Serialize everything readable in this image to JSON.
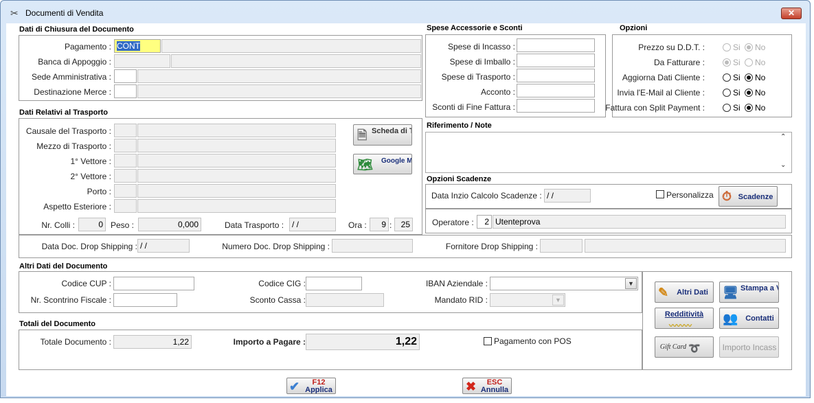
{
  "window": {
    "title": "Documenti di Vendita",
    "close": "✕"
  },
  "sections": {
    "chiusura": "Dati di Chiusura del Documento",
    "trasporto": "Dati Relativi al Trasporto",
    "spese": "Spese Accessorie e Sconti",
    "opzioni": "Opzioni",
    "riferimento": "Riferimento / Note",
    "scadenze": "Opzioni Scadenze",
    "altri": "Altri Dati del Documento",
    "totali": "Totali del Documento"
  },
  "chiusura": {
    "pagamento_label": "Pagamento :",
    "pagamento_value": "CONT",
    "banca_label": "Banca di Appoggio :",
    "sede_label": "Sede Amministrativa :",
    "destinazione_label": "Destinazione Merce :"
  },
  "trasporto": {
    "causale_label": "Causale del Trasporto :",
    "mezzo_label": "Mezzo di Trasporto :",
    "vettore1_label": "1° Vettore :",
    "vettore2_label": "2° Vettore :",
    "porto_label": "Porto :",
    "aspetto_label": "Aspetto Esteriore :",
    "colli_label": "Nr. Colli :",
    "colli_value": "0",
    "peso_label": "Peso :",
    "peso_value": "0,000",
    "data_label": "Data Trasporto :",
    "data_value": "/ /",
    "ora_label": "Ora :",
    "ora_h": "9",
    "ora_sep": ":",
    "ora_m": "25",
    "scheda_btn": "Scheda di Trasporto",
    "map_btn": "Google Map"
  },
  "dropship": {
    "data_label": "Data Doc. Drop Shipping :",
    "data_value": "/ /",
    "numero_label": "Numero Doc. Drop Shipping :",
    "fornitore_label": "Fornitore Drop Shipping :"
  },
  "spese": {
    "incasso_label": "Spese di Incasso :",
    "imballo_label": "Spese di Imballo :",
    "trasporto_label": "Spese di Trasporto :",
    "acconto_label": "Acconto :",
    "sconti_label": "Sconti di Fine Fattura :"
  },
  "opzioni": {
    "si": "Si",
    "no": "No",
    "items": [
      {
        "label": "Prezzo su D.D.T. :"
      },
      {
        "label": "Da Fatturare :"
      },
      {
        "label": "Aggiorna Dati Cliente :"
      },
      {
        "label": "Invia l'E-Mail al Cliente :"
      },
      {
        "label": "Fattura con Split Payment :"
      }
    ]
  },
  "scadenze": {
    "data_label": "Data Inzio Calcolo Scadenze :",
    "data_value": "/ /",
    "personalizza": "Personalizza",
    "scadenze_btn": "Scadenze",
    "operatore_label": "Operatore :",
    "operatore_code": "2",
    "operatore_name": "Utenteprova"
  },
  "altri": {
    "cup_label": "Codice CUP :",
    "cig_label": "Codice CIG :",
    "iban_label": "IBAN Aziendale :",
    "scontrino_label": "Nr. Scontrino Fiscale :",
    "sconto_label": "Sconto Cassa :",
    "mandato_label": "Mandato RID :"
  },
  "totali": {
    "totale_label": "Totale Documento :",
    "totale_value": "1,22",
    "importo_label": "Importo a Pagare :",
    "importo_value": "1,22",
    "pos_label": "Pagamento con POS"
  },
  "side_buttons": {
    "altri_dati": "Altri Dati",
    "stampa": "Stampa a Video",
    "redditivita": "Redditività",
    "contatti": "Contatti",
    "gift": "Gift Card",
    "importo_incass": "Importo Incass"
  },
  "footer": {
    "applica_key": "F12",
    "applica": "Applica",
    "annulla_key": "ESC",
    "annulla": "Annulla"
  }
}
